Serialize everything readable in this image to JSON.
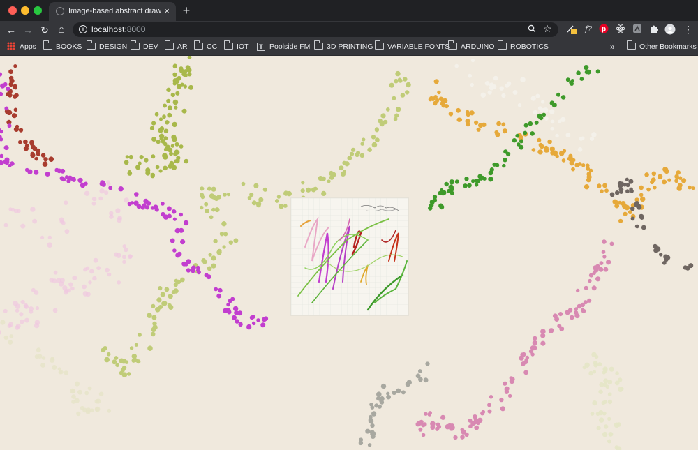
{
  "window": {
    "traffic_lights": [
      "#ff5f57",
      "#febc2e",
      "#28c840"
    ]
  },
  "tab": {
    "title": "Image-based abstract drawing",
    "close_glyph": "×",
    "new_tab_glyph": "+"
  },
  "toolbar": {
    "back_glyph": "←",
    "forward_glyph": "→",
    "reload_glyph": "↻",
    "home_glyph": "⌂",
    "url_host": "localhost",
    "url_port": ":8000",
    "menu_glyph": "⋮"
  },
  "bookmarks": {
    "apps_label": "Apps",
    "items": [
      "BOOKS",
      "DESIGN",
      "DEV",
      "AR",
      "CC",
      "IOT",
      "Poolside FM",
      "3D PRINTING",
      "VARIABLE FONTS",
      "ARDUINO",
      "ROBOTICS"
    ],
    "overflow_glyph": "»",
    "other_label": "Other Bookmarks"
  },
  "canvas": {
    "background": "#f0e9dd",
    "trail_colors": [
      "#a8b84a",
      "#c0cc78",
      "#c23ecf",
      "#a83c2e",
      "#e6a93a",
      "#3e9a2a",
      "#6f6661",
      "#d889b2",
      "#efc8e0",
      "#a8a8a0"
    ]
  }
}
